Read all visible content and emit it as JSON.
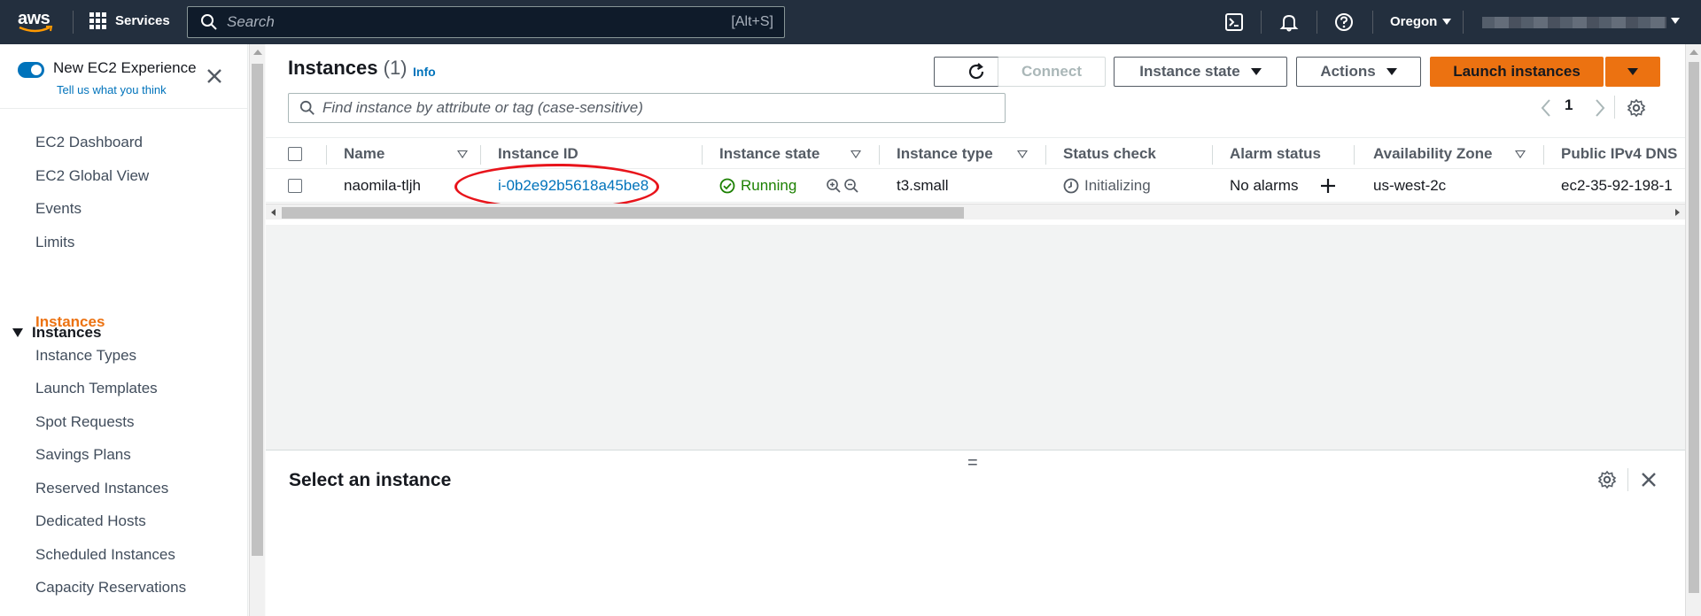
{
  "topnav": {
    "logo_text": "aws",
    "services_label": "Services",
    "search_placeholder": "Search",
    "search_shortcut": "[Alt+S]",
    "region": "Oregon"
  },
  "sidebar": {
    "new_experience_label": "New EC2 Experience",
    "tell_us_label": "Tell us what you think",
    "items": [
      {
        "label": "EC2 Dashboard"
      },
      {
        "label": "EC2 Global View"
      },
      {
        "label": "Events"
      },
      {
        "label": "Limits"
      }
    ],
    "section_label": "Instances",
    "section_items": [
      {
        "label": "Instances",
        "active": true
      },
      {
        "label": "Instance Types"
      },
      {
        "label": "Launch Templates"
      },
      {
        "label": "Spot Requests"
      },
      {
        "label": "Savings Plans"
      },
      {
        "label": "Reserved Instances"
      },
      {
        "label": "Dedicated Hosts"
      },
      {
        "label": "Scheduled Instances"
      },
      {
        "label": "Capacity Reservations"
      }
    ]
  },
  "instances": {
    "title": "Instances",
    "count": "(1)",
    "info_label": "Info",
    "connect_label": "Connect",
    "instance_state_label": "Instance state",
    "actions_label": "Actions",
    "launch_label": "Launch instances",
    "filter_placeholder": "Find instance by attribute or tag (case-sensitive)",
    "page_number": "1",
    "columns": [
      "Name",
      "Instance ID",
      "Instance state",
      "Instance type",
      "Status check",
      "Alarm status",
      "Availability Zone",
      "Public IPv4 DNS"
    ],
    "rows": [
      {
        "name": "naomila-tljh",
        "instance_id": "i-0b2e92b5618a45be8",
        "state": "Running",
        "type": "t3.small",
        "status_check": "Initializing",
        "alarm_status": "No alarms",
        "availability_zone": "us-west-2c",
        "public_dns": "ec2-35-92-198-1"
      }
    ]
  },
  "detail": {
    "title": "Select an instance",
    "handle": "="
  },
  "colors": {
    "nav_bg": "#232f3e",
    "accent_orange": "#ec7211",
    "link_blue": "#0073bb",
    "running_green": "#1d8102",
    "highlight_red": "#e8141b"
  }
}
